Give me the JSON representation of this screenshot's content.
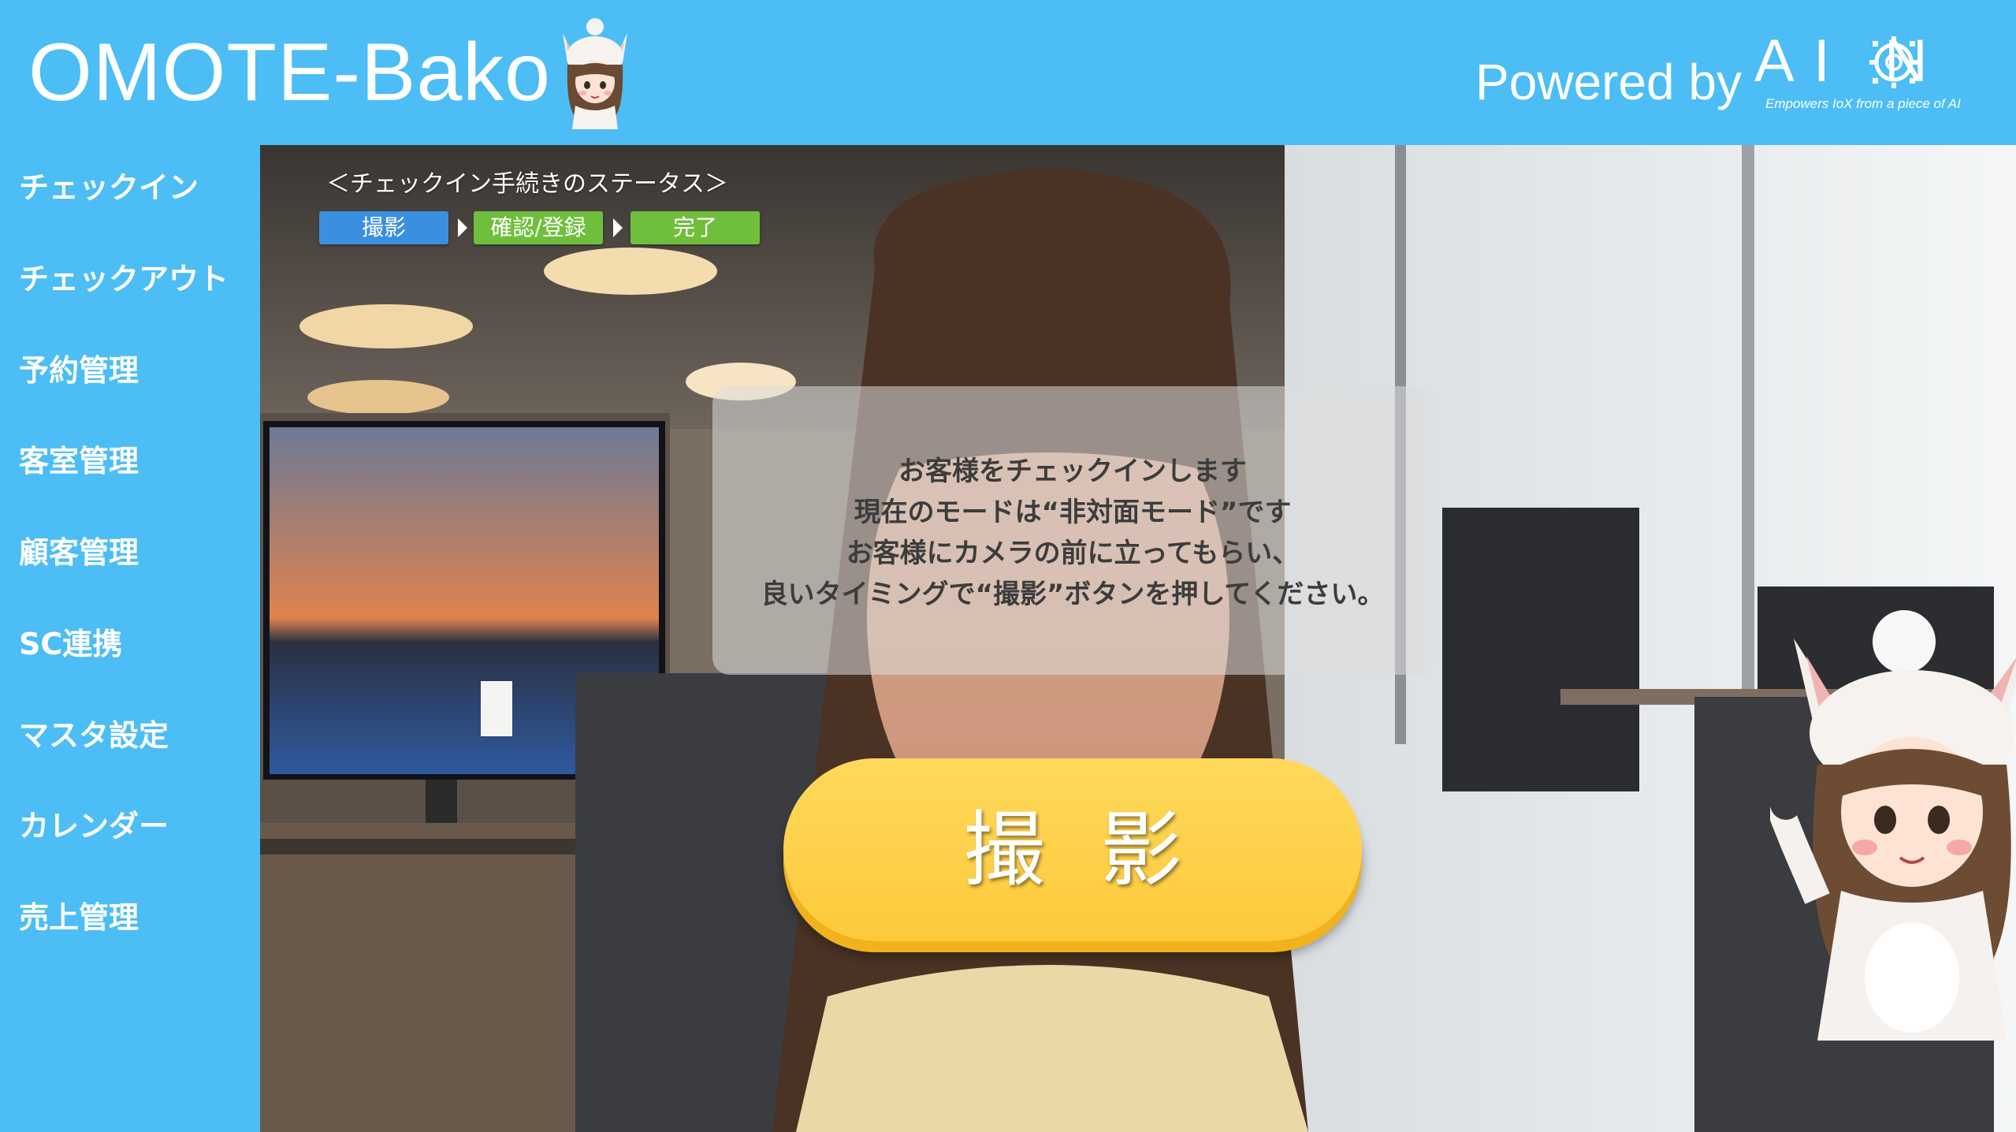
{
  "header": {
    "app_title": "OMOTE-Bako",
    "powered_by": "Powered by",
    "logo_word": "AI N",
    "logo_tagline": "Empowers IoX from a piece of AI"
  },
  "sidebar": {
    "items": [
      {
        "label": "チェックイン"
      },
      {
        "label": "チェックアウト"
      },
      {
        "label": "予約管理"
      },
      {
        "label": "客室管理"
      },
      {
        "label": "顧客管理"
      },
      {
        "label": "SC連携"
      },
      {
        "label": "マスタ設定"
      },
      {
        "label": "カレンダー"
      },
      {
        "label": "売上管理"
      }
    ]
  },
  "status": {
    "title": "＜チェックイン手続きのステータス＞",
    "steps": [
      {
        "label": "撮影",
        "state": "current"
      },
      {
        "label": "確認/登録",
        "state": "pending"
      },
      {
        "label": "完了",
        "state": "pending"
      }
    ]
  },
  "instruction": {
    "lines": [
      "お客様をチェックインします",
      "現在のモードは“非対面モード”です",
      "お客様にカメラの前に立ってもらい、",
      "良いタイミングで“撮影”ボタンを押してください。"
    ]
  },
  "capture_button": {
    "label": "撮影"
  },
  "colors": {
    "brand": "#4cbdf5",
    "step_current": "#3a8fe0",
    "step_pending": "#6fbf3c",
    "button": "#fdc93a"
  }
}
